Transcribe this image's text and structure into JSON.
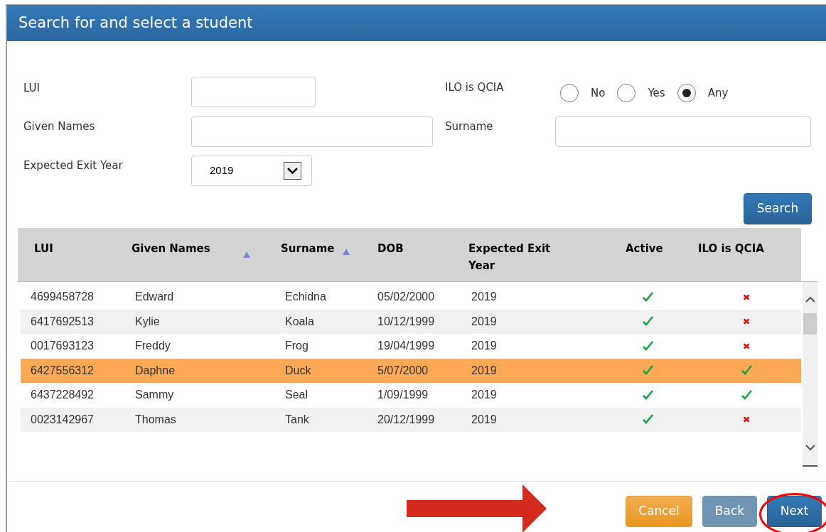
{
  "window": {
    "title": "Search for and select a student"
  },
  "form": {
    "lui": {
      "label": "LUI"
    },
    "given_names": {
      "label": "Given Names"
    },
    "surname": {
      "label": "Surname"
    },
    "exit_year": {
      "label": "Expected Exit Year",
      "value": "2019"
    },
    "ilo": {
      "label": "ILO is QCIA",
      "options": [
        {
          "label": "No",
          "selected": false
        },
        {
          "label": "Yes",
          "selected": false
        },
        {
          "label": "Any",
          "selected": true
        }
      ]
    },
    "search_button": "Search"
  },
  "table": {
    "columns": [
      {
        "label": "LUI",
        "sorted": false
      },
      {
        "label": "Given Names",
        "sorted": true
      },
      {
        "label": "Surname",
        "sorted": true
      },
      {
        "label": "DOB",
        "sorted": false
      },
      {
        "label": "Expected Exit Year",
        "sorted": false
      },
      {
        "label": "Active",
        "sorted": false
      },
      {
        "label": "ILO is QCIA",
        "sorted": false
      }
    ],
    "rows": [
      {
        "lui": "4699458728",
        "given_names": "Edward",
        "surname": "Echidna",
        "dob": "05/02/2000",
        "exit_year": "2019",
        "active": true,
        "ilo_is_qcia": false,
        "selected": false
      },
      {
        "lui": "6417692513",
        "given_names": "Kylie",
        "surname": "Koala",
        "dob": "10/12/1999",
        "exit_year": "2019",
        "active": true,
        "ilo_is_qcia": false,
        "selected": false
      },
      {
        "lui": "0017693123",
        "given_names": "Freddy",
        "surname": "Frog",
        "dob": "19/04/1999",
        "exit_year": "2019",
        "active": true,
        "ilo_is_qcia": false,
        "selected": false
      },
      {
        "lui": "6427556312",
        "given_names": "Daphne",
        "surname": "Duck",
        "dob": "5/07/2000",
        "exit_year": "2019",
        "active": true,
        "ilo_is_qcia": true,
        "selected": true
      },
      {
        "lui": "6437228492",
        "given_names": "Sammy",
        "surname": "Seal",
        "dob": "1/09/1999",
        "exit_year": "2019",
        "active": true,
        "ilo_is_qcia": true,
        "selected": false
      },
      {
        "lui": "0023142967",
        "given_names": "Thomas",
        "surname": "Tank",
        "dob": "20/12/1999",
        "exit_year": "2019",
        "active": true,
        "ilo_is_qcia": false,
        "selected": false
      }
    ]
  },
  "footer": {
    "buttons": [
      {
        "label": "Cancel",
        "kind": "cancel"
      },
      {
        "label": "Back",
        "kind": "back"
      },
      {
        "label": "Next",
        "kind": "next",
        "highlighted": true
      }
    ]
  }
}
